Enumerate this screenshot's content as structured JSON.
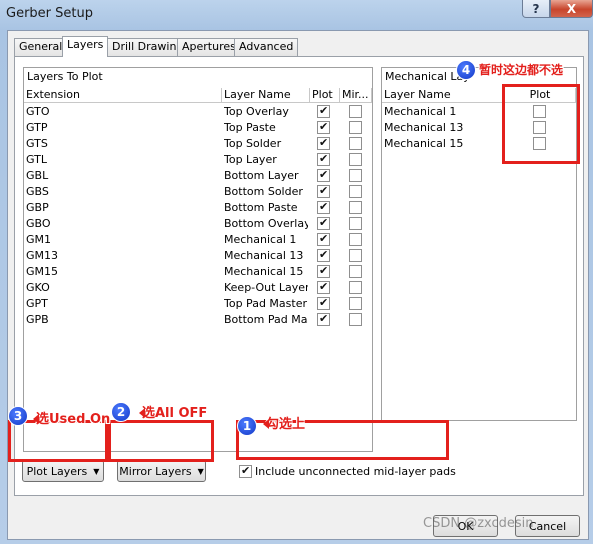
{
  "window": {
    "title": "Gerber Setup"
  },
  "caption_buttons": {
    "help": "?",
    "close": "X"
  },
  "tabs": [
    "General",
    "Layers",
    "Drill Drawing",
    "Apertures",
    "Advanced"
  ],
  "layers_to_plot": {
    "title": "Layers To Plot",
    "headers": {
      "extension": "Extension",
      "layer_name": "Layer Name",
      "plot": "Plot",
      "mirror": "Mir..."
    },
    "rows": [
      {
        "ext": "GTO",
        "name": "Top Overlay",
        "plot": true,
        "mirror": false
      },
      {
        "ext": "GTP",
        "name": "Top Paste",
        "plot": true,
        "mirror": false
      },
      {
        "ext": "GTS",
        "name": "Top Solder",
        "plot": true,
        "mirror": false
      },
      {
        "ext": "GTL",
        "name": "Top Layer",
        "plot": true,
        "mirror": false
      },
      {
        "ext": "GBL",
        "name": "Bottom Layer",
        "plot": true,
        "mirror": false
      },
      {
        "ext": "GBS",
        "name": "Bottom Solder",
        "plot": true,
        "mirror": false
      },
      {
        "ext": "GBP",
        "name": "Bottom Paste",
        "plot": true,
        "mirror": false
      },
      {
        "ext": "GBO",
        "name": "Bottom Overlay",
        "plot": true,
        "mirror": false
      },
      {
        "ext": "GM1",
        "name": "Mechanical 1",
        "plot": true,
        "mirror": false
      },
      {
        "ext": "GM13",
        "name": "Mechanical 13",
        "plot": true,
        "mirror": false
      },
      {
        "ext": "GM15",
        "name": "Mechanical 15",
        "plot": true,
        "mirror": false
      },
      {
        "ext": "GKO",
        "name": "Keep-Out Layer",
        "plot": true,
        "mirror": false
      },
      {
        "ext": "GPT",
        "name": "Top Pad Master",
        "plot": true,
        "mirror": false
      },
      {
        "ext": "GPB",
        "name": "Bottom Pad Maste",
        "plot": true,
        "mirror": false
      }
    ]
  },
  "mechanical": {
    "title": "Mechanical Lay",
    "headers": {
      "layer_name": "Layer Name",
      "plot": "Plot"
    },
    "rows": [
      {
        "name": "Mechanical 1",
        "plot": false
      },
      {
        "name": "Mechanical 13",
        "plot": false
      },
      {
        "name": "Mechanical 15",
        "plot": false
      }
    ]
  },
  "buttons": {
    "plot_layers": "Plot Layers",
    "mirror_layers": "Mirror Layers",
    "ok": "OK",
    "cancel": "Cancel"
  },
  "include_unconnected": {
    "label": "Include unconnected mid-layer pads",
    "checked": true
  },
  "annotations": [
    {
      "num": "1",
      "text": "勾选上"
    },
    {
      "num": "2",
      "text": "选All OFF"
    },
    {
      "num": "3",
      "text": "选Used On"
    },
    {
      "num": "4",
      "text": "暂时这边都不选"
    }
  ],
  "watermark": "CSDN @zxcdesin",
  "colors": {
    "annotation_red": "#e3201c",
    "badge_blue": "#1f4ee0",
    "title_bar": "#b6cde8"
  }
}
